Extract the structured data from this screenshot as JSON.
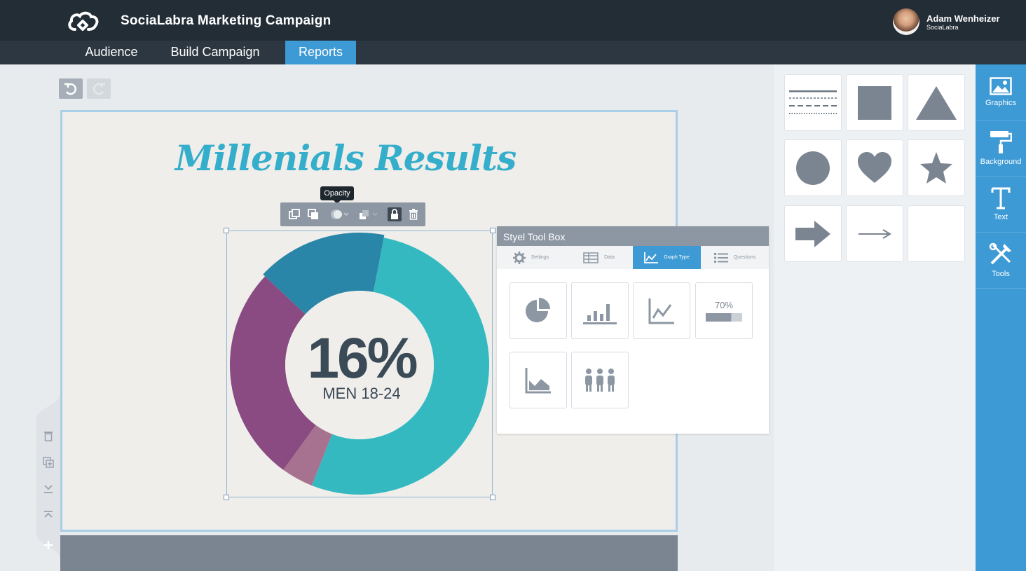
{
  "header": {
    "app_title": "SociaLabra Marketing Campaign",
    "user_name": "Adam Wenheizer",
    "user_org": "SociaLabra"
  },
  "nav": {
    "tabs": [
      {
        "label": "Audience",
        "active": false
      },
      {
        "label": "Build Campaign",
        "active": false
      },
      {
        "label": "Reports",
        "active": true
      }
    ]
  },
  "canvas": {
    "title": "Millenials Results",
    "tooltip": "Opacity",
    "donut": {
      "percent_label": "16%",
      "caption": "MEN 18-24",
      "segments": [
        {
          "color": "#8a4a82",
          "share": 0.27
        },
        {
          "color": "#2a86a8",
          "share": 0.16
        },
        {
          "color": "#34b9c1",
          "share": 0.53
        },
        {
          "color": "#a7728f",
          "share": 0.04
        }
      ]
    }
  },
  "toolbox": {
    "title": "Styel Tool Box",
    "tabs": [
      "Settings",
      "Data",
      "Graph Type",
      "Questions"
    ],
    "active_tab": "Graph Type",
    "graph_options": [
      "pie-chart-icon",
      "bar-chart-icon",
      "line-chart-icon",
      "progress-bar-icon",
      "area-chart-icon",
      "people-chart-icon"
    ],
    "progress_label": "70%"
  },
  "gallery": {
    "shapes": [
      "lines-icon",
      "square-icon",
      "triangle-icon",
      "circle-icon",
      "heart-icon",
      "star-icon",
      "arrow-block-icon",
      "arrow-line-icon",
      "empty-slot"
    ]
  },
  "rightbar": {
    "items": [
      {
        "label": "Graphics",
        "icon": "image-icon"
      },
      {
        "label": "Background",
        "icon": "paint-roller-icon"
      },
      {
        "label": "Text",
        "icon": "text-icon"
      },
      {
        "label": "Tools",
        "icon": "tools-icon"
      }
    ]
  },
  "colors": {
    "accent": "#3d9ad5",
    "topbar": "#232d36",
    "navbar": "#2c3741",
    "title": "#35aecb",
    "icon_gray": "#8c97a3"
  }
}
